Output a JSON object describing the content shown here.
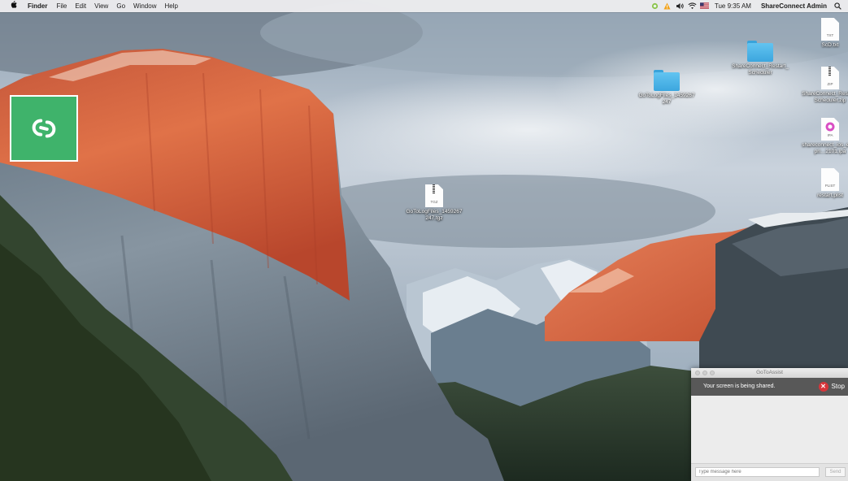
{
  "menubar": {
    "apple_icon": "apple-icon",
    "app_name": "Finder",
    "menus": [
      "File",
      "Edit",
      "View",
      "Go",
      "Window",
      "Help"
    ],
    "clock": "Tue 9:35 AM",
    "user": "ShareConnect Admin",
    "tray_icons": [
      "sync-icon",
      "warning-icon",
      "volume-icon",
      "wifi-icon",
      "flag-icon",
      "spotlight-icon"
    ]
  },
  "desktop": {
    "icons": [
      {
        "label": "GoToLogFiles_1459267247",
        "kind": "folder"
      },
      {
        "label": "ShareConnect_Restart_Scheduler",
        "kind": "folder"
      },
      {
        "label": "GoToLogFiles_1459267247.tgz",
        "kind": "archive",
        "ext": "TGZ"
      },
      {
        "label": "ScD.txt",
        "kind": "text",
        "ext": "TXT"
      },
      {
        "label": "ShareConnect_Restart_Scheduler.zip",
        "kind": "archive",
        "ext": "ZIP"
      },
      {
        "label": "shareconnect_ios_enterpri…2101.ipa",
        "kind": "ipa",
        "ext": "IPA"
      },
      {
        "label": "restart.plist",
        "kind": "plist",
        "ext": "PLIST"
      }
    ],
    "app_icon": "shareconnect-logo-icon"
  },
  "gotoassist": {
    "title": "GoToAssist",
    "sharing_message": "Your screen is being shared.",
    "stop_label": "Stop",
    "chat_placeholder": "Type message here",
    "send_label": "Send"
  },
  "colors": {
    "shareconnect_green": "#3fb36b",
    "folder_blue": "#4db5eb",
    "stop_red": "#d7353a",
    "share_bar": "#585858"
  }
}
